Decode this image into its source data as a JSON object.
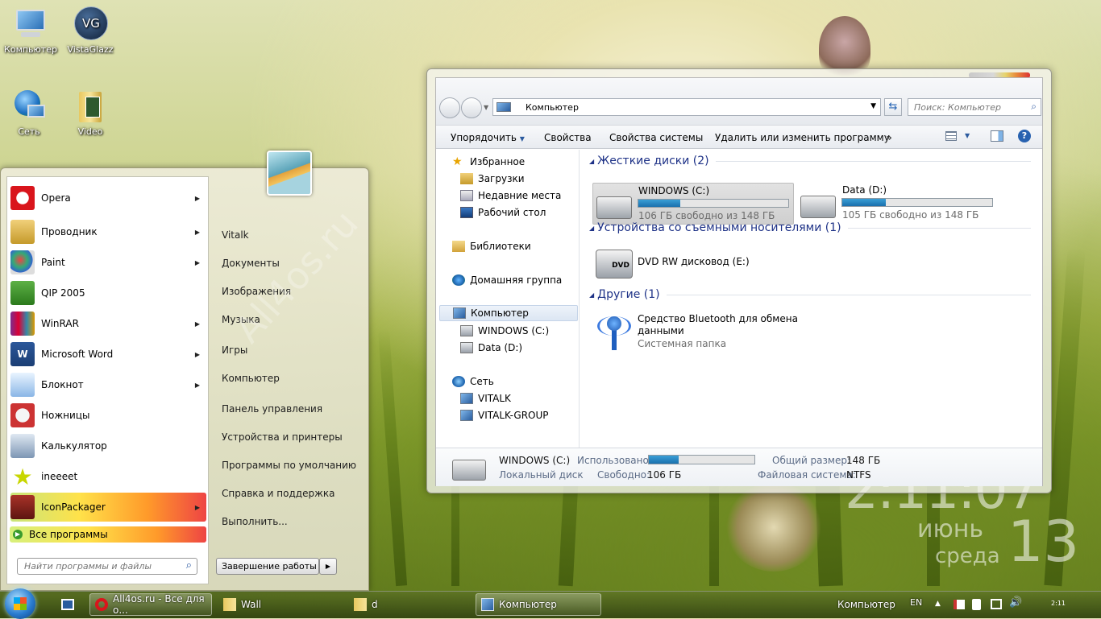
{
  "desktop": {
    "icons": [
      {
        "label": "Компьютер"
      },
      {
        "label": "VistaGlazz"
      },
      {
        "label": "Сеть"
      },
      {
        "label": "Video"
      }
    ],
    "watermark": "All4os.ru",
    "clock": {
      "time": "2:11:07",
      "month": "июнь",
      "weekday": "среда",
      "day": "13"
    }
  },
  "start_menu": {
    "programs": [
      {
        "label": "Opera",
        "icon": "opera-icon",
        "submenu": true
      },
      {
        "label": "Проводник",
        "icon": "explorer-icon",
        "submenu": true
      },
      {
        "label": "Paint",
        "icon": "paint-icon",
        "submenu": true
      },
      {
        "label": "QIP 2005",
        "icon": "qip-icon",
        "submenu": false
      },
      {
        "label": "WinRAR",
        "icon": "winrar-icon",
        "submenu": true
      },
      {
        "label": "Microsoft Word",
        "icon": "word-icon",
        "submenu": true
      },
      {
        "label": "Блокнот",
        "icon": "notepad-icon",
        "submenu": true
      },
      {
        "label": "Ножницы",
        "icon": "scissors-icon",
        "submenu": false
      },
      {
        "label": "Калькулятор",
        "icon": "calculator-icon",
        "submenu": false
      },
      {
        "label": "ineeeet",
        "icon": "star-icon",
        "submenu": false
      },
      {
        "label": "IconPackager",
        "icon": "iconpackager-icon",
        "submenu": true
      }
    ],
    "all_programs": "Все программы",
    "search_placeholder": "Найти программы и файлы",
    "places": [
      "Vitalk",
      "Документы",
      "Изображения",
      "Музыка",
      "Игры",
      "Компьютер",
      "Панель управления",
      "Устройства и принтеры",
      "Программы по умолчанию",
      "Справка и поддержка",
      "Выполнить..."
    ],
    "shutdown": "Завершение работы"
  },
  "explorer": {
    "address": "Компьютер",
    "search_placeholder": "Поиск: Компьютер",
    "toolbar": {
      "organize": "Упорядочить",
      "properties": "Свойства",
      "system_properties": "Свойства системы",
      "uninstall": "Удалить или изменить программу",
      "more": "»"
    },
    "nav": {
      "favorites": "Избранное",
      "downloads": "Загрузки",
      "recent": "Недавние места",
      "desktop": "Рабочий стол",
      "libraries": "Библиотеки",
      "homegroup": "Домашняя группа",
      "computer": "Компьютер",
      "drive_c": "WINDOWS (C:)",
      "drive_d": "Data (D:)",
      "network": "Сеть",
      "net1": "VITALK",
      "net2": "VITALK-GROUP"
    },
    "groups": {
      "hdd": "Жесткие диски (2)",
      "removable": "Устройства со съемными носителями (1)",
      "other": "Другие (1)"
    },
    "drives": [
      {
        "name": "WINDOWS (C:)",
        "free": "106 ГБ свободно из 148 ГБ",
        "used_fraction": 0.28
      },
      {
        "name": "Data (D:)",
        "free": "105 ГБ свободно из 148 ГБ",
        "used_fraction": 0.29
      }
    ],
    "dvd": {
      "name": "DVD RW дисковод (E:)",
      "badge": "DVD"
    },
    "bluetooth": {
      "name1": "Средство Bluetooth для обмена",
      "name2": "данными",
      "type": "Системная папка"
    },
    "details": {
      "name": "WINDOWS (C:)",
      "type": "Локальный диск",
      "used_label": "Использовано:",
      "used_fraction": 0.28,
      "free_label": "Свободно:",
      "free_value": "106 ГБ",
      "total_label": "Общий размер:",
      "total_value": "148 ГБ",
      "fs_label": "Файловая система:",
      "fs_value": "NTFS"
    }
  },
  "taskbar": {
    "buttons": [
      {
        "label": "All4os.ru - Все для о..."
      },
      {
        "label": "Wall"
      },
      {
        "label": "d"
      },
      {
        "label": "Компьютер"
      }
    ],
    "tray_label": "Компьютер",
    "lang": "EN",
    "time": "2:11"
  }
}
